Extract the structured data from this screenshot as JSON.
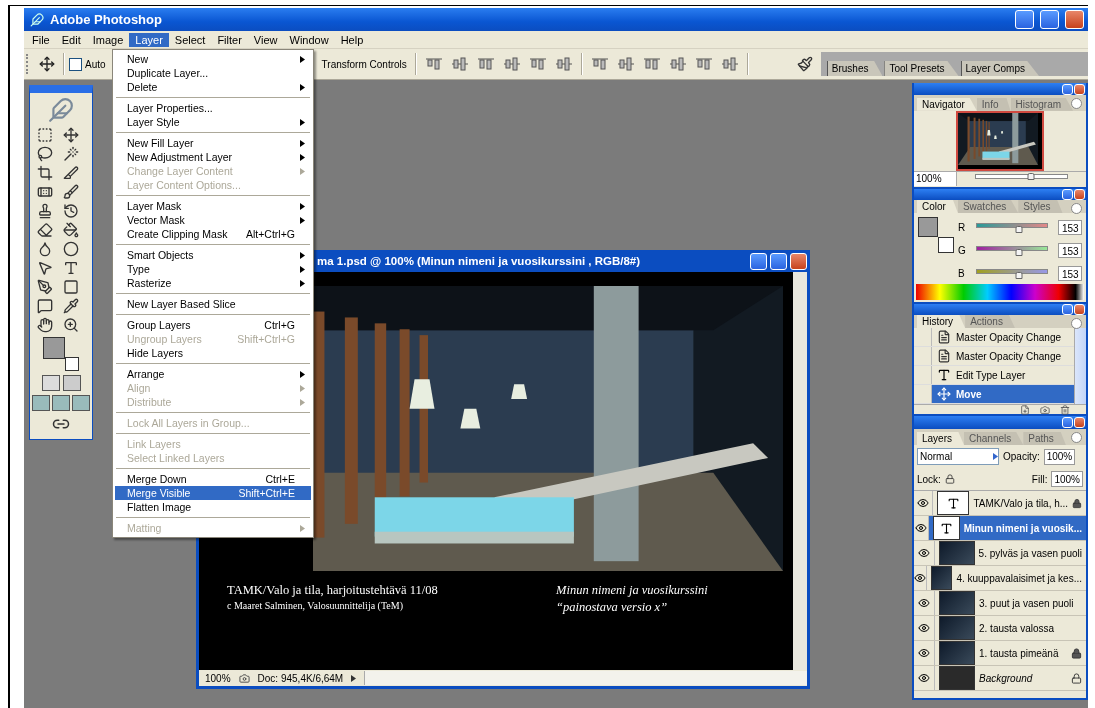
{
  "window": {
    "title": "Adobe Photoshop"
  },
  "menu_bar": [
    {
      "label": "File",
      "selected": false
    },
    {
      "label": "Edit",
      "selected": false
    },
    {
      "label": "Image",
      "selected": false
    },
    {
      "label": "Layer",
      "selected": true
    },
    {
      "label": "Select",
      "selected": false
    },
    {
      "label": "Filter",
      "selected": false
    },
    {
      "label": "View",
      "selected": false
    },
    {
      "label": "Window",
      "selected": false
    },
    {
      "label": "Help",
      "selected": false
    }
  ],
  "options_bar": {
    "auto_select": {
      "label": "Auto",
      "checked": false
    },
    "transform_label": "Transform Controls"
  },
  "palette_well": [
    {
      "label": "Brushes"
    },
    {
      "label": "Tool Presets"
    },
    {
      "label": "Layer Comps"
    }
  ],
  "layer_menu": {
    "groups": [
      {
        "items": [
          {
            "label": "New",
            "submenu": true,
            "disabled": false,
            "selected": false
          },
          {
            "label": "Duplicate Layer...",
            "submenu": false,
            "disabled": false,
            "selected": false
          },
          {
            "label": "Delete",
            "submenu": true,
            "disabled": false,
            "selected": false
          }
        ]
      },
      {
        "items": [
          {
            "label": "Layer Properties...",
            "submenu": false,
            "disabled": false,
            "selected": false
          },
          {
            "label": "Layer Style",
            "submenu": true,
            "disabled": false,
            "selected": false
          }
        ]
      },
      {
        "items": [
          {
            "label": "New Fill Layer",
            "submenu": true,
            "disabled": false,
            "selected": false
          },
          {
            "label": "New Adjustment Layer",
            "submenu": true,
            "disabled": false,
            "selected": false
          },
          {
            "label": "Change Layer Content",
            "submenu": true,
            "disabled": true,
            "selected": false
          },
          {
            "label": "Layer Content Options...",
            "submenu": false,
            "disabled": true,
            "selected": false
          }
        ]
      },
      {
        "items": [
          {
            "label": "Layer Mask",
            "submenu": true,
            "disabled": false,
            "selected": false
          },
          {
            "label": "Vector Mask",
            "submenu": true,
            "disabled": false,
            "selected": false
          },
          {
            "label": "Create Clipping Mask",
            "shortcut": "Alt+Ctrl+G",
            "submenu": false,
            "disabled": false,
            "selected": false
          }
        ]
      },
      {
        "items": [
          {
            "label": "Smart Objects",
            "submenu": true,
            "disabled": false,
            "selected": false
          },
          {
            "label": "Type",
            "submenu": true,
            "disabled": false,
            "selected": false
          },
          {
            "label": "Rasterize",
            "submenu": true,
            "disabled": false,
            "selected": false
          }
        ]
      },
      {
        "items": [
          {
            "label": "New Layer Based Slice",
            "submenu": false,
            "disabled": false,
            "selected": false
          }
        ]
      },
      {
        "items": [
          {
            "label": "Group Layers",
            "shortcut": "Ctrl+G",
            "submenu": false,
            "disabled": false,
            "selected": false
          },
          {
            "label": "Ungroup Layers",
            "shortcut": "Shift+Ctrl+G",
            "submenu": false,
            "disabled": true,
            "selected": false
          },
          {
            "label": "Hide Layers",
            "submenu": false,
            "disabled": false,
            "selected": false
          }
        ]
      },
      {
        "items": [
          {
            "label": "Arrange",
            "submenu": true,
            "disabled": false,
            "selected": false
          },
          {
            "label": "Align",
            "submenu": true,
            "disabled": true,
            "selected": false
          },
          {
            "label": "Distribute",
            "submenu": true,
            "disabled": true,
            "selected": false
          }
        ]
      },
      {
        "items": [
          {
            "label": "Lock All Layers in Group...",
            "submenu": false,
            "disabled": true,
            "selected": false
          }
        ]
      },
      {
        "items": [
          {
            "label": "Link Layers",
            "submenu": false,
            "disabled": true,
            "selected": false
          },
          {
            "label": "Select Linked Layers",
            "submenu": false,
            "disabled": true,
            "selected": false
          }
        ]
      },
      {
        "items": [
          {
            "label": "Merge Down",
            "shortcut": "Ctrl+E",
            "submenu": false,
            "disabled": false,
            "selected": false
          },
          {
            "label": "Merge Visible",
            "shortcut": "Shift+Ctrl+E",
            "submenu": false,
            "disabled": false,
            "selected": true
          },
          {
            "label": "Flatten Image",
            "submenu": false,
            "disabled": false,
            "selected": false
          }
        ]
      },
      {
        "items": [
          {
            "label": "Matting",
            "submenu": true,
            "disabled": true,
            "selected": false
          }
        ]
      }
    ]
  },
  "document": {
    "title": "ma 1.psd @ 100% (Minun nimeni ja vuosikurssini , RGB/8#)",
    "caption_left": [
      "TAMK/Valo ja tila, harjoitustehtävä 11/08",
      "c Maaret Salminen, Valosuunnittelija (TeM)"
    ],
    "caption_right": [
      "Minun nimeni ja vuosikurssini",
      "“painostava versio x”"
    ],
    "zoom": "100%",
    "doc_info": "Doc: 945,4K/6,64M"
  },
  "navigator": {
    "tabs": [
      {
        "label": "Navigator",
        "selected": true
      },
      {
        "label": "Info",
        "selected": false
      },
      {
        "label": "Histogram",
        "selected": false
      }
    ],
    "zoom": "100%",
    "level": 0.6
  },
  "color": {
    "tabs": [
      {
        "label": "Color",
        "selected": true
      },
      {
        "label": "Swatches",
        "selected": false
      },
      {
        "label": "Styles",
        "selected": false
      }
    ],
    "channels": [
      {
        "name": "R",
        "value": "153",
        "level": 0.6
      },
      {
        "name": "G",
        "value": "153",
        "level": 0.6
      },
      {
        "name": "B",
        "value": "153",
        "level": 0.6
      }
    ]
  },
  "history": {
    "tabs": [
      {
        "label": "History",
        "selected": true
      },
      {
        "label": "Actions",
        "selected": false
      }
    ],
    "items": [
      {
        "label": "Master Opacity Change",
        "kind": "document",
        "selected": false
      },
      {
        "label": "Master Opacity Change",
        "kind": "document",
        "selected": false
      },
      {
        "label": "Edit Type Layer",
        "kind": "type",
        "selected": false
      },
      {
        "label": "Move",
        "kind": "move",
        "selected": true
      }
    ]
  },
  "layers": {
    "tabs": [
      {
        "label": "Layers",
        "selected": true
      },
      {
        "label": "Channels",
        "selected": false
      },
      {
        "label": "Paths",
        "selected": false
      }
    ],
    "blend_mode": "Normal",
    "opacity_label": "Opacity:",
    "opacity": "100%",
    "lock_label": "Lock:",
    "fill_label": "Fill:",
    "fill": "100%",
    "items": [
      {
        "name": "TAMK/Valo ja tila, h...",
        "kind": "text",
        "visible": true,
        "locked": true,
        "selected": false
      },
      {
        "name": "Minun nimeni ja vuosik...",
        "kind": "text",
        "visible": true,
        "locked": false,
        "selected": true
      },
      {
        "name": "5. pylväs ja vasen puoli",
        "kind": "image",
        "visible": true,
        "locked": false,
        "selected": false
      },
      {
        "name": "4. kuuppavalaisimet ja kes...",
        "kind": "image",
        "visible": true,
        "locked": false,
        "selected": false
      },
      {
        "name": "3. puut ja vasen puoli",
        "kind": "image",
        "visible": true,
        "locked": false,
        "selected": false
      },
      {
        "name": "2. tausta valossa",
        "kind": "image",
        "visible": true,
        "locked": false,
        "selected": false
      },
      {
        "name": "1. tausta pimeänä",
        "kind": "image",
        "visible": true,
        "locked": true,
        "selected": false
      },
      {
        "name": "Background",
        "kind": "background",
        "visible": true,
        "locked": true,
        "selected": false
      }
    ]
  }
}
